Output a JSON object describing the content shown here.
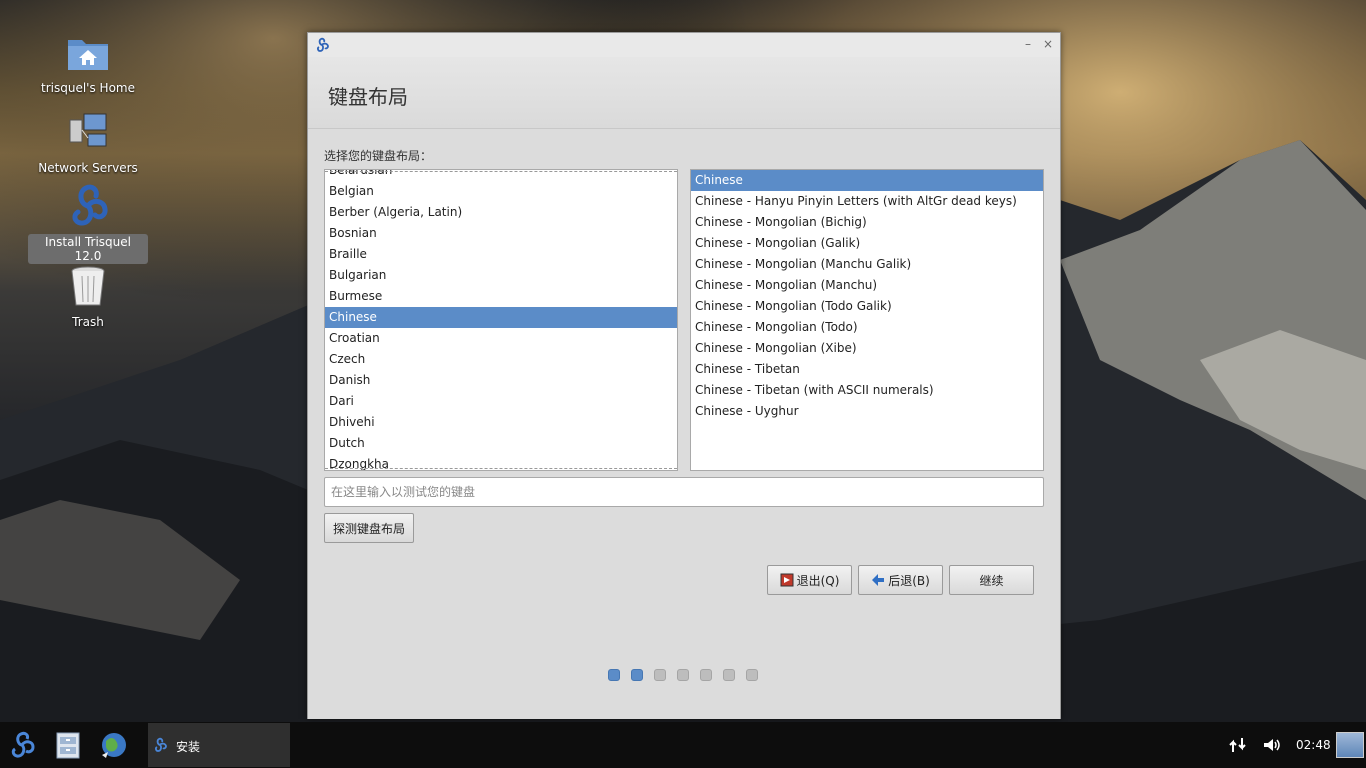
{
  "desktop": {
    "icons": [
      {
        "label": "trisquel's Home",
        "icon": "home-folder-icon"
      },
      {
        "label": "Network Servers",
        "icon": "network-servers-icon"
      },
      {
        "label": "Install Trisquel 12.0",
        "icon": "trisquel-installer-icon",
        "selected": true
      },
      {
        "label": "Trash",
        "icon": "trash-icon"
      }
    ]
  },
  "window": {
    "controls": {
      "minimize": "–",
      "close": "×"
    },
    "header_title": "键盘布局",
    "prompt": "选择您的键盘布局：",
    "layouts": [
      "Belarusian",
      "Belgian",
      "Berber (Algeria, Latin)",
      "Bosnian",
      "Braille",
      "Bulgarian",
      "Burmese",
      "Chinese",
      "Croatian",
      "Czech",
      "Danish",
      "Dari",
      "Dhivehi",
      "Dutch",
      "Dzongkha"
    ],
    "selected_layout": "Chinese",
    "variants": [
      "Chinese",
      "Chinese - Hanyu Pinyin Letters (with AltGr dead keys)",
      "Chinese - Mongolian (Bichig)",
      "Chinese - Mongolian (Galik)",
      "Chinese - Mongolian (Manchu Galik)",
      "Chinese - Mongolian (Manchu)",
      "Chinese - Mongolian (Todo Galik)",
      "Chinese - Mongolian (Todo)",
      "Chinese - Mongolian (Xibe)",
      "Chinese - Tibetan",
      "Chinese - Tibetan (with ASCII numerals)",
      "Chinese - Uyghur"
    ],
    "selected_variant": "Chinese",
    "test_placeholder": "在这里输入以测试您的键盘",
    "detect_label": "探测键盘布局",
    "quit_label": "退出(Q)",
    "back_label": "后退(B)",
    "continue_label": "继续",
    "progress": {
      "total_steps": 7,
      "completed_steps": 2
    },
    "accent": "#5b8cc8"
  },
  "taskbar": {
    "task_title": "安装",
    "clock": "02:48",
    "launchers": [
      "trisquel-menu-icon",
      "file-manager-icon",
      "web-browser-icon"
    ],
    "tray_icons": [
      "network-icon",
      "volume-icon",
      "show-desktop-icon"
    ]
  }
}
